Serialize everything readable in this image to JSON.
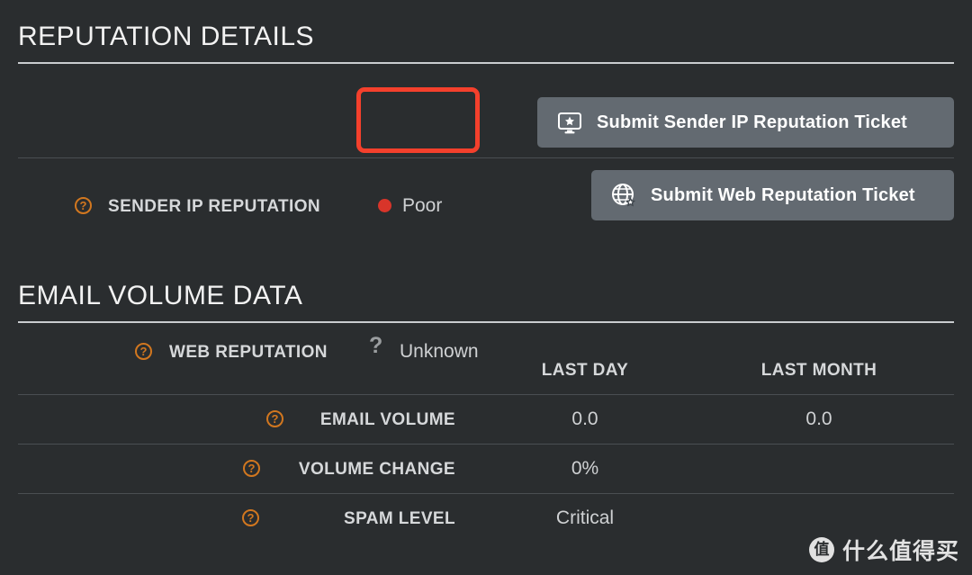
{
  "theme": {
    "background": "#2a2d2f",
    "accent_orange": "#d2771f",
    "annotation_red": "#f4402c",
    "status_red": "#d8352a",
    "button_bg": "#636a71",
    "rule_bright": "#c9cccf",
    "rule_dim": "#4a4e52"
  },
  "reputation_section": {
    "title": "REPUTATION DETAILS",
    "rows": [
      {
        "help_icon": "question-circle-icon",
        "label": "SENDER IP REPUTATION",
        "status": "Poor",
        "status_indicator": "red-dot-icon",
        "highlighted": "true",
        "button": {
          "label": "Submit Sender IP Reputation Ticket",
          "icon": "monitor-star-icon"
        }
      },
      {
        "help_icon": "question-circle-icon",
        "label": "WEB REPUTATION",
        "status": "Unknown",
        "status_indicator": "question-mark-icon",
        "highlighted": "false",
        "button": {
          "label": "Submit Web Reputation Ticket",
          "icon": "globe-star-icon"
        }
      }
    ]
  },
  "email_volume_section": {
    "title": "EMAIL VOLUME DATA",
    "columns": [
      "LAST DAY",
      "LAST MONTH"
    ],
    "rows": [
      {
        "help_icon": "question-circle-icon",
        "label": "EMAIL VOLUME",
        "last_day": "0.0",
        "last_month": "0.0"
      },
      {
        "help_icon": "question-circle-icon",
        "label": "VOLUME CHANGE",
        "last_day": "0%",
        "last_month": ""
      },
      {
        "help_icon": "question-circle-icon",
        "label": "SPAM LEVEL",
        "last_day": "Critical",
        "last_month": ""
      }
    ]
  },
  "watermark": {
    "logo_char": "值",
    "text": "什么值得买"
  }
}
